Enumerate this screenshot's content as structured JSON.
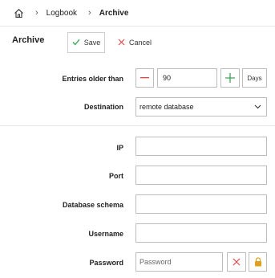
{
  "breadcrumb": {
    "home_icon": "home-icon",
    "items": [
      "Logbook",
      "Archive"
    ]
  },
  "toolbar": {
    "title": "Archive",
    "save_label": "Save",
    "cancel_label": "Cancel"
  },
  "form": {
    "entries_older_than": {
      "label": "Entries older than",
      "value": "90",
      "unit_button": "Days"
    },
    "destination": {
      "label": "Destination",
      "value": "remote database"
    },
    "ip": {
      "label": "IP",
      "value": ""
    },
    "port": {
      "label": "Port",
      "value": ""
    },
    "database_schema": {
      "label": "Database schema",
      "value": ""
    },
    "username": {
      "label": "Username",
      "value": ""
    },
    "password": {
      "label": "Password",
      "placeholder": "Password"
    }
  },
  "colors": {
    "danger": "#e04848",
    "success": "#3aa757",
    "warning": "#e0a020",
    "border": "#bdbdbd"
  }
}
